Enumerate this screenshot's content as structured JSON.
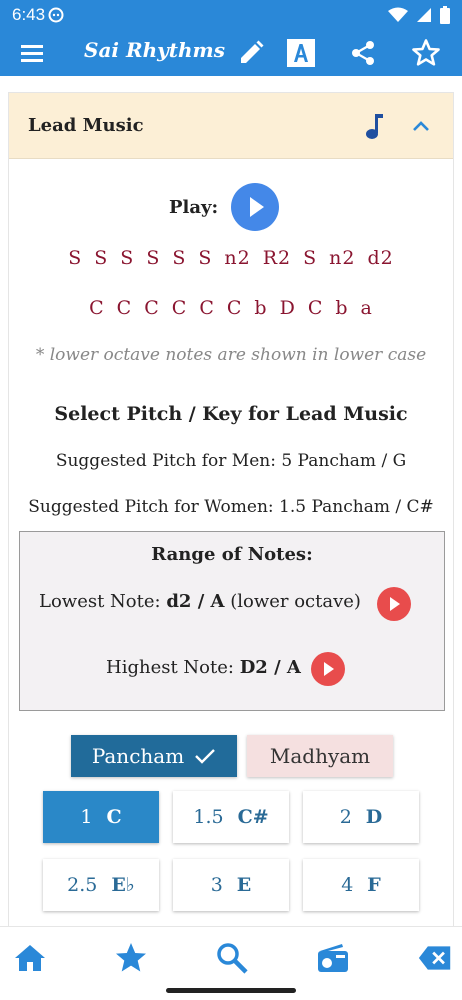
{
  "status": {
    "time": "6:43"
  },
  "appbar": {
    "title": "Sai Rhythms",
    "icons": [
      "menu-icon",
      "pencil-icon",
      "font-icon",
      "share-icon",
      "star-icon"
    ]
  },
  "card": {
    "header_label": "Lead Music",
    "play_label": "Play:",
    "swaras": [
      "S",
      "S",
      "S",
      "S",
      "S",
      "S",
      "n2",
      "R2",
      "S",
      "n2",
      "d2"
    ],
    "western": [
      "C",
      "C",
      "C",
      "C",
      "C",
      "C",
      "b",
      "D",
      "C",
      "b",
      "a"
    ],
    "hint": "* lower octave notes are shown in lower case",
    "select_title": "Select Pitch / Key for Lead Music",
    "suggested_men": "Suggested Pitch for Men: 5 Pancham / G",
    "suggested_women": "Suggested Pitch for Women: 1.5 Pancham / C#",
    "range": {
      "title": "Range of Notes:",
      "lowest_prefix": "Lowest Note: ",
      "lowest_value": "d2 / A",
      "lowest_suffix": " (lower octave)",
      "highest_prefix": "Highest Note: ",
      "highest_value": "D2 / A"
    },
    "scale_options": {
      "pancham": "Pancham",
      "madhyam": "Madhyam",
      "selected": "Pancham"
    },
    "pitches": [
      {
        "num": "1",
        "key": "C",
        "active": true
      },
      {
        "num": "1.5",
        "key": "C#",
        "active": false
      },
      {
        "num": "2",
        "key": "D",
        "active": false
      },
      {
        "num": "2.5",
        "key": "E♭",
        "active": false
      },
      {
        "num": "3",
        "key": "E",
        "active": false
      },
      {
        "num": "4",
        "key": "F",
        "active": false
      }
    ]
  },
  "bottom_nav": [
    "home-icon",
    "star-icon",
    "search-icon",
    "radio-icon",
    "backspace-icon"
  ],
  "colors": {
    "primary": "#2a88d8",
    "header_bg": "#fcefd6",
    "notes": "#8a1530",
    "play_blue": "#4488e8",
    "play_red": "#e84c4c",
    "pancham_bg": "#216b9a",
    "madhyam_bg": "#f5e0e0",
    "pitch_active": "#2a88c8"
  }
}
